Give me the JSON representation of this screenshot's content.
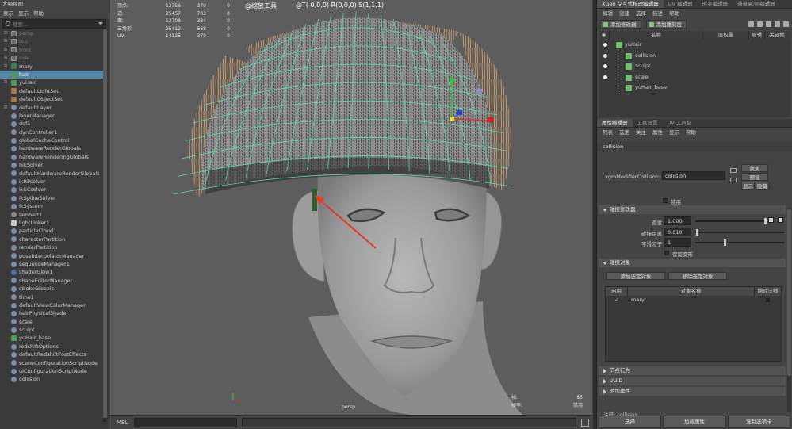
{
  "outliner": {
    "title": "大纲视图",
    "menu": [
      "展示",
      "显示",
      "帮助"
    ],
    "search_placeholder": "搜索...",
    "items": [
      {
        "label": "persp",
        "icon": "camera-icon",
        "dim": true,
        "expand": "+"
      },
      {
        "label": "top",
        "icon": "camera-icon",
        "dim": true,
        "expand": "+"
      },
      {
        "label": "front",
        "icon": "camera-icon",
        "dim": true,
        "expand": "+"
      },
      {
        "label": "side",
        "icon": "camera-icon",
        "dim": true,
        "expand": "+"
      },
      {
        "label": "mary",
        "icon": "mesh-icon",
        "expand": "+"
      },
      {
        "label": "hair",
        "icon": "hair-icon",
        "selected": true
      },
      {
        "label": "yuHair",
        "icon": "hair-icon",
        "expand": "+"
      },
      {
        "label": "defaultLightSet",
        "icon": "set-icon"
      },
      {
        "label": "defaultObjectSet",
        "icon": "set-icon"
      },
      {
        "label": "defaultLayer",
        "icon": "node-icon",
        "expand": "+"
      },
      {
        "label": "layerManager",
        "icon": "node-icon"
      },
      {
        "label": "dof1",
        "icon": "node-icon"
      },
      {
        "label": "dynController1",
        "icon": "node-icon"
      },
      {
        "label": "globalCacheControl",
        "icon": "node-icon"
      },
      {
        "label": "hardwareRenderGlobals",
        "icon": "node-icon"
      },
      {
        "label": "hardwareRenderingGlobals",
        "icon": "node-icon"
      },
      {
        "label": "hikSolver",
        "icon": "node-icon"
      },
      {
        "label": "defaultHardwareRenderGlobals",
        "icon": "node-icon"
      },
      {
        "label": "ikRPsolver",
        "icon": "node-icon"
      },
      {
        "label": "ikSCsolver",
        "icon": "node-icon"
      },
      {
        "label": "ikSplineSolver",
        "icon": "node-icon"
      },
      {
        "label": "ikSystem",
        "icon": "node-icon"
      },
      {
        "label": "lambert1",
        "icon": "grey-icon"
      },
      {
        "label": "lightLinker1",
        "icon": "light-icon"
      },
      {
        "label": "particleCloud1",
        "icon": "node-icon"
      },
      {
        "label": "characterPartition",
        "icon": "node-icon"
      },
      {
        "label": "renderPartition",
        "icon": "node-icon"
      },
      {
        "label": "poseInterpolatorManager",
        "icon": "node-icon"
      },
      {
        "label": "sequenceManager1",
        "icon": "node-icon"
      },
      {
        "label": "shaderGlow1",
        "icon": "shader-icon"
      },
      {
        "label": "shapeEditorManager",
        "icon": "node-icon"
      },
      {
        "label": "strokeGlobals",
        "icon": "node-icon"
      },
      {
        "label": "time1",
        "icon": "node-icon"
      },
      {
        "label": "defaultViewColorManager",
        "icon": "node-icon"
      },
      {
        "label": "hairPhysicalShader",
        "icon": "node-icon"
      },
      {
        "label": "scale",
        "icon": "node-icon"
      },
      {
        "label": "sculpt",
        "icon": "node-icon"
      },
      {
        "label": "yuHair_base",
        "icon": "hair-icon"
      },
      {
        "label": "redshiftOptions",
        "icon": "node-icon"
      },
      {
        "label": "defaultRedshiftPostEffects",
        "icon": "node-icon"
      },
      {
        "label": "sceneConfigurationScriptNode",
        "icon": "node-icon"
      },
      {
        "label": "uiConfigurationScriptNode",
        "icon": "node-icon"
      },
      {
        "label": "collision",
        "icon": "node-icon"
      }
    ]
  },
  "viewport": {
    "hud_stats": [
      {
        "k": "顶点:",
        "a": "12756",
        "b": "370",
        "c": "0"
      },
      {
        "k": "边:",
        "a": "25457",
        "b": "703",
        "c": "0"
      },
      {
        "k": "面:",
        "a": "12708",
        "b": "334",
        "c": "0"
      },
      {
        "k": "三角形:",
        "a": "25412",
        "b": "668",
        "c": "0"
      },
      {
        "k": "UV:",
        "a": "14126",
        "b": "379",
        "c": "0"
      }
    ],
    "tool_label": "@缩放工具",
    "transform_label": "@T( 0,0,0)   R(0,0,0)   S(1,1,1)",
    "bottom_stats": [
      {
        "k": "帧:",
        "v": "85"
      },
      {
        "k": "帧率:",
        "v": "禁用"
      }
    ],
    "camera_label": "persp"
  },
  "mel": {
    "label": "MEL"
  },
  "right": {
    "tabs": [
      "XGen 交互式梳理编辑器",
      "UV 编辑器",
      "形变编辑器",
      "通道盒/层编辑器"
    ],
    "menu": [
      "编辑",
      "创建",
      "选择",
      "描述",
      "帮助"
    ],
    "add_modifier": "添加修改器",
    "add_sculpt_layer": "添加雕刻层",
    "mod_columns": [
      "名称",
      "层权重",
      "编辑",
      "关键帧"
    ],
    "mod_tree": [
      {
        "label": "yuHair",
        "level": 0,
        "dot": false
      },
      {
        "label": "collision",
        "level": 1,
        "dot": true
      },
      {
        "label": "sculpt",
        "level": 1,
        "dot": true
      },
      {
        "label": "scale",
        "level": 1,
        "dot": true
      },
      {
        "label": "yuHair_base",
        "level": 1,
        "dot": false
      }
    ],
    "attr_tabs": [
      "属性编辑器",
      "工具设置",
      "UV 工具包"
    ],
    "attr_menu": [
      "列表",
      "选定",
      "关注",
      "属性",
      "显示",
      "帮助"
    ],
    "node_name": "collision",
    "node_type_label": "xgmModifierCollision:",
    "node_value": "collision",
    "btn_focus": "聚焦",
    "btn_preset": "预设",
    "btn_show": "显示",
    "btn_hide": "隐藏",
    "disable_label": "禁用",
    "section_collision_mod": "碰撞修改器",
    "mask_label": "遮罩",
    "mask_value": "1.000",
    "mask_fraction": 1.0,
    "distance_label": "碰撞距离",
    "distance_value": "0.010",
    "distance_fraction": 0.01,
    "smooth_label": "平滑因子",
    "smooth_value": "1",
    "smooth_fraction": 0.33,
    "keep_deform_label": "保留变形",
    "section_collision_obj": "碰撞对象",
    "btn_add_selected": "添加选定对象",
    "btn_remove_selected": "移除选定对象",
    "coll_columns": [
      "启用",
      "对象名称",
      "翻转法线"
    ],
    "coll_rows": [
      {
        "enabled": "✓",
        "name": "mary",
        "flip": ""
      }
    ],
    "section_node_behavior": "节点行为",
    "section_uuid": "UUID",
    "section_extra": "附加属性",
    "notes_label": "注释: collision",
    "bottom_buttons": [
      "选择",
      "加载属性",
      "复制选项卡"
    ]
  }
}
